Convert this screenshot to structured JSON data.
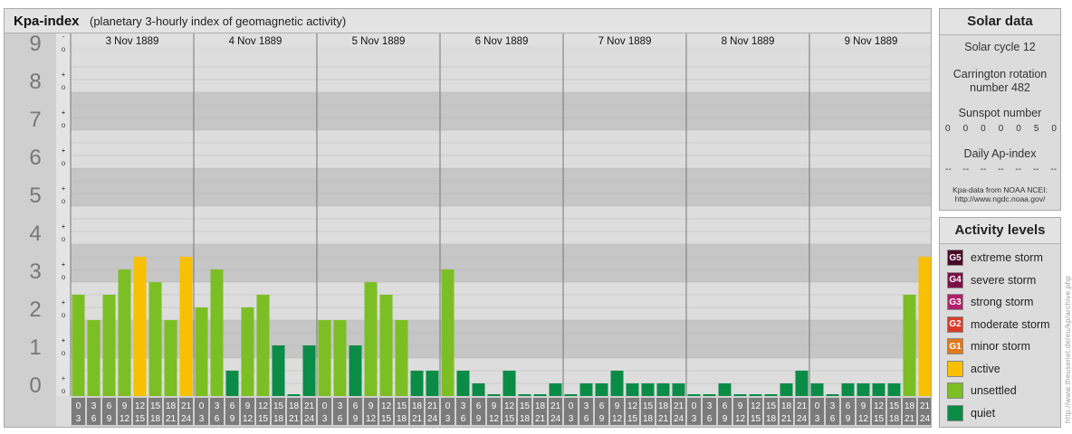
{
  "title": {
    "main": "Kpa-index",
    "sub": "(planetary 3-hourly index of geomagnetic activity)"
  },
  "chart_data": {
    "type": "bar",
    "title": "Kpa-index",
    "subtitle": "(planetary 3-hourly index of geomagnetic activity)",
    "ylim": [
      0,
      9
    ],
    "y_ticks": [
      "0",
      "1",
      "2",
      "3",
      "4",
      "5",
      "6",
      "7",
      "8",
      "9"
    ],
    "y_subticks": [
      "-",
      "o",
      "+"
    ],
    "days": [
      "3 Nov 1889",
      "4 Nov 1889",
      "5 Nov 1889",
      "6 Nov 1889",
      "7 Nov 1889",
      "8 Nov 1889",
      "9 Nov 1889"
    ],
    "interval_labels": [
      [
        "0",
        "3"
      ],
      [
        "3",
        "6"
      ],
      [
        "6",
        "9"
      ],
      [
        "9",
        "12"
      ],
      [
        "12",
        "15"
      ],
      [
        "15",
        "18"
      ],
      [
        "18",
        "21"
      ],
      [
        "21",
        "24"
      ]
    ],
    "values": [
      2.667,
      2.0,
      2.667,
      3.333,
      3.667,
      3.0,
      2.0,
      3.667,
      2.333,
      3.333,
      0.667,
      2.333,
      2.667,
      1.333,
      0.0,
      1.333,
      2.0,
      2.0,
      1.333,
      3.0,
      2.667,
      2.0,
      0.667,
      0.667,
      3.333,
      0.667,
      0.333,
      0.0,
      0.667,
      0.0,
      0.0,
      0.333,
      0.0,
      0.333,
      0.333,
      0.667,
      0.333,
      0.333,
      0.333,
      0.333,
      0.0,
      0.0,
      0.333,
      0.0,
      0.0,
      0.0,
      0.333,
      0.667,
      0.333,
      0.0,
      0.333,
      0.333,
      0.333,
      0.333,
      2.667,
      3.667
    ],
    "categories_colors": {
      "active": "#f8c000",
      "unsettled": "#7cbf24",
      "quiet": "#0b8c46"
    }
  },
  "solar_data": {
    "heading": "Solar data",
    "cycle": "Solar cycle 12",
    "carrington_1": "Carrington rotation",
    "carrington_2": "number 482",
    "sunspot_label": "Sunspot number",
    "sunspot_values": [
      "0",
      "0",
      "0",
      "0",
      "0",
      "5",
      "0"
    ],
    "ap_label": "Daily Ap-index",
    "ap_values": [
      "--",
      "--",
      "--",
      "--",
      "--",
      "--",
      "--"
    ],
    "note_1": "Kpa-data from NOAA NCEI:",
    "note_2": "http://www.ngdc.noaa.gov/"
  },
  "activity_levels": {
    "heading": "Activity levels",
    "items": [
      {
        "code": "G5",
        "label": "extreme storm",
        "color": "#4a0a2a"
      },
      {
        "code": "G4",
        "label": "severe storm",
        "color": "#7a1048"
      },
      {
        "code": "G3",
        "label": "strong storm",
        "color": "#b0206a"
      },
      {
        "code": "G2",
        "label": "moderate storm",
        "color": "#d83c28"
      },
      {
        "code": "G1",
        "label": "minor storm",
        "color": "#e07a1a"
      },
      {
        "code": "",
        "label": "active",
        "color": "#f8c000"
      },
      {
        "code": "",
        "label": "unsettled",
        "color": "#7cbf24"
      },
      {
        "code": "",
        "label": "quiet",
        "color": "#0b8c46"
      }
    ]
  },
  "watermark": "http://www.theusenet.de/eu/kp/archive.php"
}
